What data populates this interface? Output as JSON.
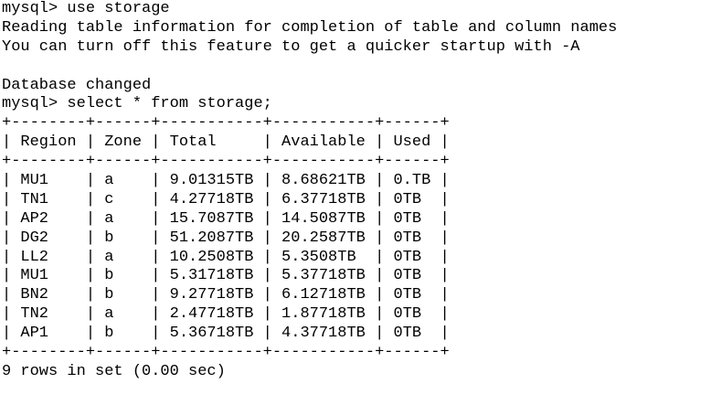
{
  "terminal": {
    "lines": [
      "mysql> use storage",
      "Reading table information for completion of table and column names",
      "You can turn off this feature to get a quicker startup with -A",
      "",
      "Database changed",
      "mysql> select * from storage;",
      "+--------+------+-----------+-----------+------+",
      "| Region | Zone | Total     | Available | Used |",
      "+--------+------+-----------+-----------+------+",
      "| MU1    | a    | 9.01315TB | 8.68621TB | 0.TB |",
      "| TN1    | c    | 4.27718TB | 6.37718TB | 0TB  |",
      "| AP2    | a    | 15.7087TB | 14.5087TB | 0TB  |",
      "| DG2    | b    | 51.2087TB | 20.2587TB | 0TB  |",
      "| LL2    | a    | 10.2508TB | 5.3508TB  | 0TB  |",
      "| MU1    | b    | 5.31718TB | 5.37718TB | 0TB  |",
      "| BN2    | b    | 9.27718TB | 6.12718TB | 0TB  |",
      "| TN2    | a    | 2.47718TB | 1.87718TB | 0TB  |",
      "| AP1    | b    | 5.36718TB | 4.37718TB | 0TB  |",
      "+--------+------+-----------+-----------+------+",
      "9 rows in set (0.00 sec)",
      ""
    ],
    "prompt_remnant": "  -  ",
    "cursor_color": "#00e000"
  }
}
